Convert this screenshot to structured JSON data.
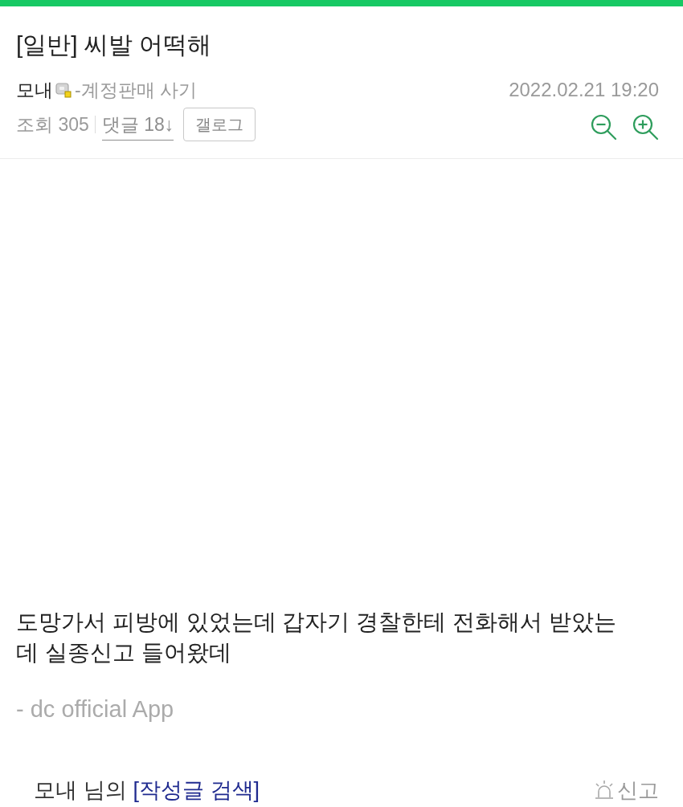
{
  "post": {
    "title": "[일반] 씨발 어떡해",
    "author": "모내",
    "author_note": "-계정판매 사기",
    "date": "2022.02.21 19:20",
    "views": "조회 305",
    "comments": "댓글 18↓",
    "gallog_button": "갤로그"
  },
  "body": {
    "lines": [
      "도망가서 피방에 있었는데 갑자기 경찰한테 전화해서 받았는",
      "데 실종신고 들어왔데"
    ],
    "signature": "- dc official App"
  },
  "footer": {
    "author_text": "모내 님의",
    "search_link": "[작성글 검색]",
    "report": "신고"
  }
}
